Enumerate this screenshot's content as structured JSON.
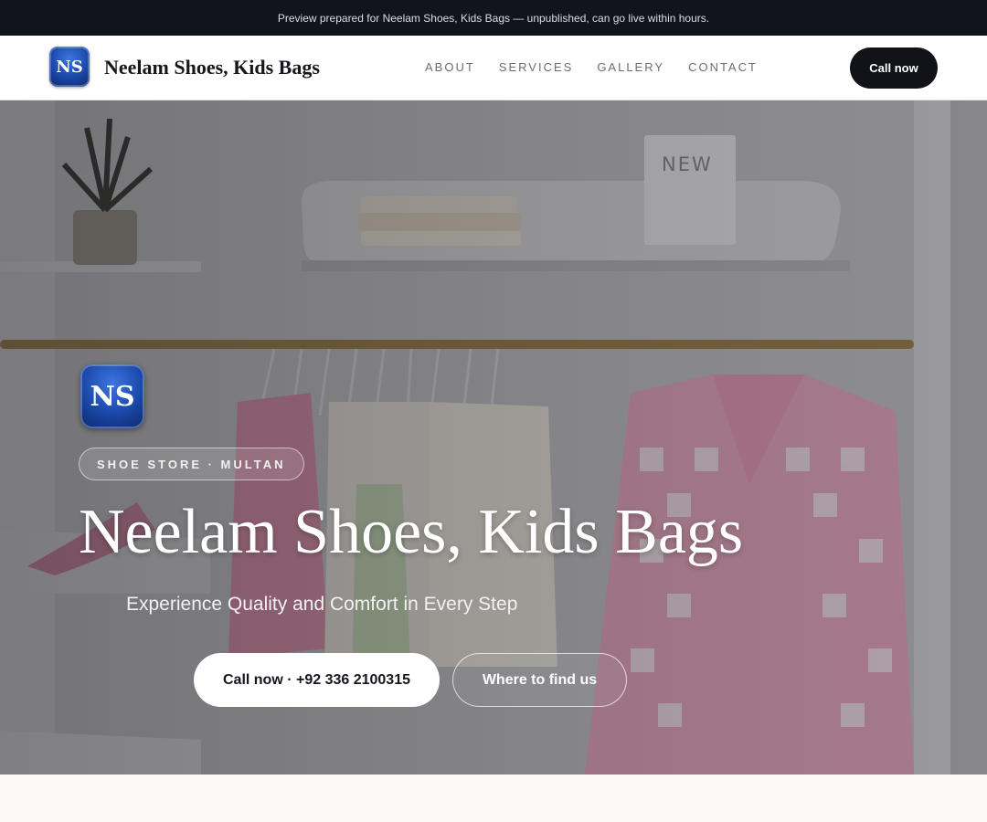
{
  "banner": {
    "text": "Preview prepared for Neelam Shoes, Kids Bags — unpublished, can go live within hours."
  },
  "header": {
    "logo_initials": "NS",
    "brand_name": "Neelam Shoes, Kids Bags",
    "nav": [
      {
        "label": "ABOUT"
      },
      {
        "label": "SERVICES"
      },
      {
        "label": "GALLERY"
      },
      {
        "label": "CONTACT"
      }
    ],
    "call_label": "Call now"
  },
  "hero": {
    "logo_initials": "NS",
    "tag": "SHOE STORE · MULTAN",
    "title": "Neelam Shoes, Kids Bags",
    "subtitle": "Experience Quality and Comfort in Every Step",
    "primary_cta": "Call now · +92 336 2100315",
    "secondary_cta": "Where to find us",
    "photo_sign_text": "NEW"
  },
  "colors": {
    "banner_bg": "#11141b",
    "accent_dark": "#111318",
    "logo_blue": "#1b47a8"
  }
}
